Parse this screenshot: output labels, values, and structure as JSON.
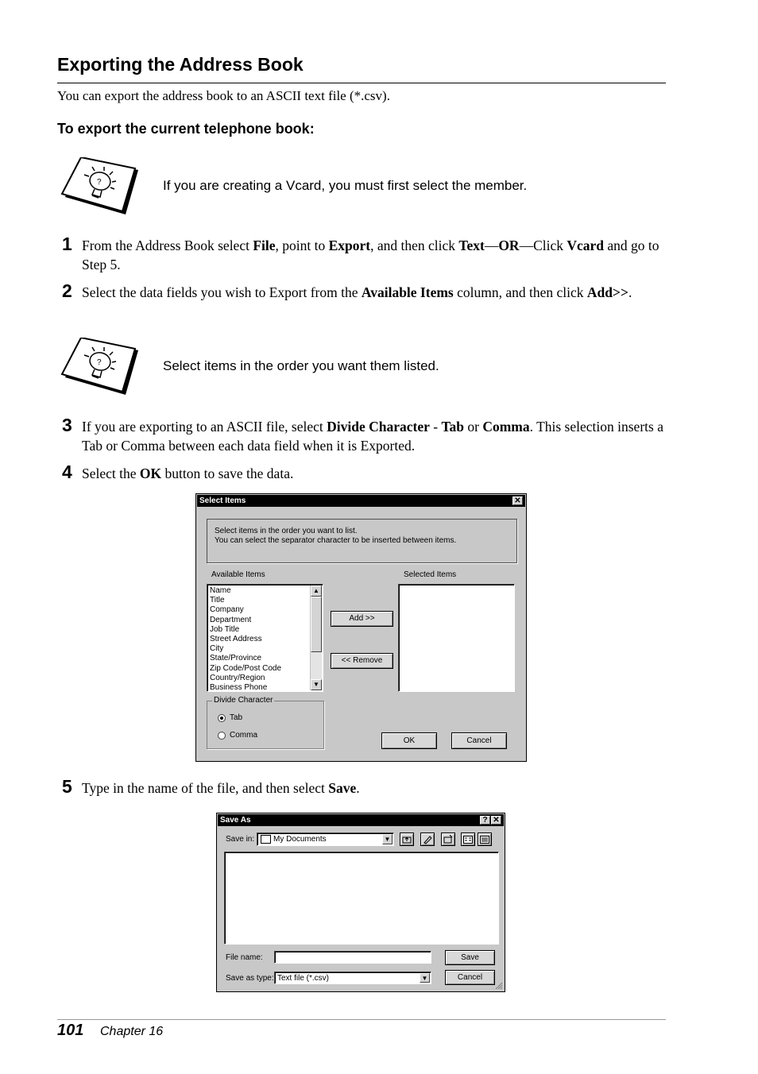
{
  "page": {
    "heading": "Exporting the Address Book",
    "intro": "You can export the address book to an ASCII text file (*.csv).",
    "subheading": "To export the current telephone book:",
    "note1": "If you are creating a Vcard, you must first select the member.",
    "note2": "Select items in the order you want them listed.",
    "footer": {
      "page_number": "101",
      "chapter": "Chapter 16"
    }
  },
  "steps": {
    "s1": {
      "num": "1",
      "t1": "From the Address Book select ",
      "b1": "File",
      "t2": ", point to ",
      "b2": "Export",
      "t3": ", and then click ",
      "b3": "Text",
      "t4": "—",
      "b4": "OR",
      "t5": "—Click ",
      "b5": "Vcard",
      "t6": " and go to Step 5."
    },
    "s2": {
      "num": "2",
      "t1": "Select the data fields you wish to Export from the ",
      "b1": "Available Items",
      "t2": " column, and then click ",
      "b2": "Add>>",
      "t3": "."
    },
    "s3": {
      "num": "3",
      "t1": "If you are exporting to an ASCII file, select ",
      "b1": "Divide Character",
      "t2": " - ",
      "b2": "Tab",
      "t3": " or ",
      "b3": "Comma",
      "t4": ". This selection inserts a Tab or Comma between each data field when it is Exported."
    },
    "s4": {
      "num": "4",
      "t1": "Select the ",
      "b1": "OK",
      "t2": " button to save the data."
    },
    "s5": {
      "num": "5",
      "t1": "Type in the name of the file, and then select ",
      "b1": "Save",
      "t2": "."
    }
  },
  "select_items_dialog": {
    "title": "Select Items",
    "close": "✕",
    "instructions_line1": "Select items in the order you want to list.",
    "instructions_line2": "You can select the separator character to be inserted between items.",
    "available_label": "Available Items",
    "selected_label": "Selected Items",
    "available_items": [
      "Name",
      "Title",
      "Company",
      "Department",
      "Job Title",
      "Street Address",
      "City",
      "State/Province",
      "Zip Code/Post Code",
      "Country/Region",
      "Business Phone"
    ],
    "add_button": "Add >>",
    "remove_button": "<< Remove",
    "divide_label": "Divide Character",
    "radio_tab": "Tab",
    "radio_comma": "Comma",
    "ok_button": "OK",
    "cancel_button": "Cancel"
  },
  "save_as_dialog": {
    "title": "Save As",
    "help": "?",
    "close": "✕",
    "save_in_label": "Save in:",
    "save_in_value": "My Documents",
    "file_name_label": "File name:",
    "file_name_value": "",
    "save_type_label": "Save as type:",
    "save_type_value": "Text file (*.csv)",
    "save_button": "Save",
    "cancel_button": "Cancel"
  }
}
